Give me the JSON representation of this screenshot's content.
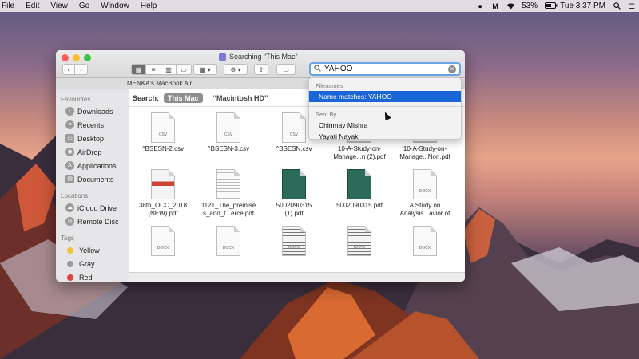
{
  "menubar": {
    "items": [
      "File",
      "Edit",
      "View",
      "Go",
      "Window",
      "Help"
    ],
    "battery": "53%",
    "clock": "Tue 3:37 PM",
    "icons": [
      "record-icon",
      "malwarebytes-icon",
      "wifi-icon",
      "battery-icon",
      "spotlight-icon",
      "menu-icon"
    ]
  },
  "window": {
    "title": "Searching “This Mac”",
    "path_label": "MENKA's MacBook Air",
    "search": {
      "value": "YAHOO"
    },
    "toolbar_icons": [
      "back-icon",
      "forward-icon",
      "icon-view-icon",
      "list-view-icon",
      "column-view-icon",
      "cover-flow-icon",
      "arrange-icon",
      "action-gear-icon",
      "share-icon",
      "tag-icon"
    ]
  },
  "sidebar": {
    "favourites_header": "Favourites",
    "favourites": [
      "Downloads",
      "Recents",
      "Desktop",
      "AirDrop",
      "Applications",
      "Documents"
    ],
    "locations_header": "Locations",
    "locations": [
      "iCloud Drive",
      "Remote Disc"
    ],
    "tags_header": "Tags",
    "tags": [
      {
        "label": "Yellow",
        "color": "#f5c12e"
      },
      {
        "label": "Gray",
        "color": "#9a9a9a"
      },
      {
        "label": "Red",
        "color": "#e0433a"
      }
    ]
  },
  "scope": {
    "label": "Search:",
    "this_mac": "This Mac",
    "disk": "“Macintosh HD”"
  },
  "files": [
    {
      "name1": "^BSESN-2.csv",
      "name2": "",
      "ext": "CSV",
      "kind": "csv"
    },
    {
      "name1": "^BSESN-3.csv",
      "name2": "",
      "ext": "CSV",
      "kind": "csv"
    },
    {
      "name1": "^BSESN.csv",
      "name2": "",
      "ext": "CSV",
      "kind": "csv"
    },
    {
      "name1": "10-A-Study-on-",
      "name2": "Manage...n (2).pdf",
      "ext": "",
      "kind": "lines"
    },
    {
      "name1": "10-A-Study-on-",
      "name2": "Manage...Non.pdf",
      "ext": "",
      "kind": "lines"
    },
    {
      "name1": "38th_OCC_2018",
      "name2": "(NEW).pdf",
      "ext": "",
      "kind": "red"
    },
    {
      "name1": "1121_The_premise",
      "name2": "s_and_t...erce.pdf",
      "ext": "",
      "kind": "lines"
    },
    {
      "name1": "5002090315",
      "name2": "(1).pdf",
      "ext": "",
      "kind": "green"
    },
    {
      "name1": "5002090315.pdf",
      "name2": "",
      "ext": "",
      "kind": "green"
    },
    {
      "name1": "A Study on",
      "name2": "Analysis...avior of",
      "ext": "DOCX",
      "kind": "docx"
    },
    {
      "name1": "",
      "name2": "",
      "ext": "DOCX",
      "kind": "docx"
    },
    {
      "name1": "",
      "name2": "",
      "ext": "DOCX",
      "kind": "docx"
    },
    {
      "name1": "",
      "name2": "",
      "ext": "DOCX",
      "kind": "scan"
    },
    {
      "name1": "",
      "name2": "",
      "ext": "DOCX",
      "kind": "scan"
    },
    {
      "name1": "",
      "name2": "",
      "ext": "DOCX",
      "kind": "docx"
    }
  ],
  "dropdown": {
    "filenames_header": "Filenames",
    "name_match": "Name matches: YAHOO",
    "sent_by_header": "Sent By",
    "senders": [
      "Chinmay Mishra",
      "Yayati Nayak"
    ]
  }
}
